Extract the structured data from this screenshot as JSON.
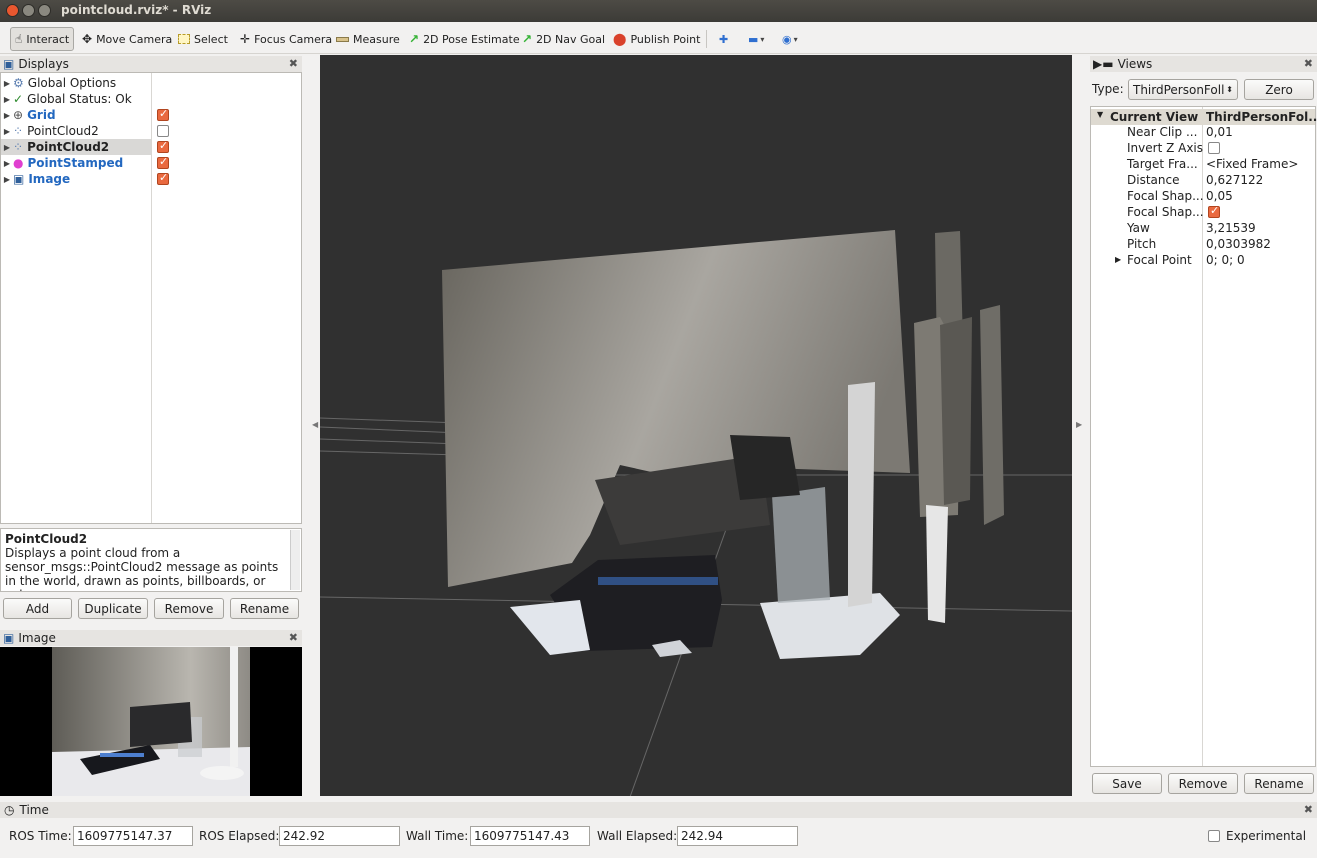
{
  "window": {
    "title": "pointcloud.rviz* - RViz"
  },
  "toolbar": {
    "interact": "Interact",
    "move_camera": "Move Camera",
    "select": "Select",
    "focus_camera": "Focus Camera",
    "measure": "Measure",
    "pose_estimate": "2D Pose Estimate",
    "nav_goal": "2D Nav Goal",
    "publish_point": "Publish Point"
  },
  "displays": {
    "title": "Displays",
    "items": [
      {
        "label": "Global Options"
      },
      {
        "label": "Global Status: Ok"
      },
      {
        "label": "Grid"
      },
      {
        "label": "PointCloud2"
      },
      {
        "label": "PointCloud2"
      },
      {
        "label": "PointStamped"
      },
      {
        "label": "Image"
      }
    ],
    "description_title": "PointCloud2",
    "description_text": "Displays a point cloud from a sensor_msgs::PointCloud2 message as points in the world, drawn as points, billboards, or cubes.",
    "buttons": {
      "add": "Add",
      "duplicate": "Duplicate",
      "remove": "Remove",
      "rename": "Rename"
    }
  },
  "image_panel": {
    "title": "Image"
  },
  "views": {
    "title": "Views",
    "type_label": "Type:",
    "type_value": "ThirdPersonFoll",
    "zero": "Zero",
    "current_view": "Current View",
    "current_view_value": "ThirdPersonFol...",
    "props": [
      {
        "name": "Near Clip ...",
        "value": "0,01"
      },
      {
        "name": "Invert Z Axis",
        "value": ""
      },
      {
        "name": "Target Fra...",
        "value": "<Fixed Frame>"
      },
      {
        "name": "Distance",
        "value": "0,627122"
      },
      {
        "name": "Focal Shap...",
        "value": "0,05"
      },
      {
        "name": "Focal Shap...",
        "value": ""
      },
      {
        "name": "Yaw",
        "value": "3,21539"
      },
      {
        "name": "Pitch",
        "value": "0,0303982"
      },
      {
        "name": "Focal Point",
        "value": "0; 0; 0"
      }
    ],
    "buttons": {
      "save": "Save",
      "remove": "Remove",
      "rename": "Rename"
    }
  },
  "time": {
    "title": "Time",
    "ros_time_label": "ROS Time:",
    "ros_time": "1609775147.37",
    "ros_elapsed_label": "ROS Elapsed:",
    "ros_elapsed": "242.92",
    "wall_time_label": "Wall Time:",
    "wall_time": "1609775147.43",
    "wall_elapsed_label": "Wall Elapsed:",
    "wall_elapsed": "242.94",
    "experimental": "Experimental"
  },
  "colors": {
    "accent": "#e9693f",
    "link": "#2368c0",
    "viewport_bg": "#303030"
  }
}
